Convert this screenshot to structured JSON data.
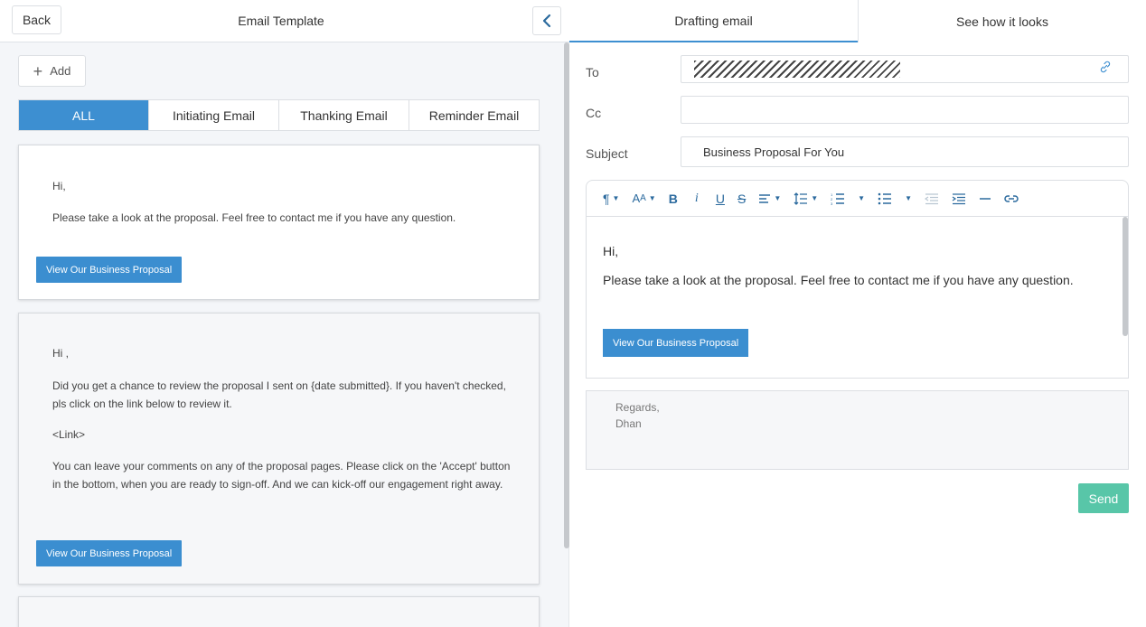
{
  "left_panel": {
    "back_label": "Back",
    "title": "Email Template",
    "add_label": "Add",
    "filters": [
      "ALL",
      "Initiating Email",
      "Thanking Email",
      "Reminder Email"
    ],
    "active_filter": "ALL",
    "cards": [
      {
        "greeting": "Hi,",
        "paragraphs": [
          "Please take a look at the proposal. Feel free to contact me if you have any question."
        ],
        "cta": "View Our Business Proposal"
      },
      {
        "greeting": "Hi ,",
        "paragraphs": [
          "Did you get a chance to review the proposal I sent on {date submitted}. If you haven't checked, pls click on the link below to review it.",
          "<Link>",
          "You can leave your comments on any of the proposal pages. Please click on the 'Accept'  button in the bottom, when you are ready to sign-off. And we can kick-off our engagement right away."
        ],
        "cta": "View Our Business Proposal"
      }
    ]
  },
  "right_panel": {
    "tabs": [
      "Drafting email",
      "See how it looks"
    ],
    "active_tab": "Drafting email",
    "to_label": "To",
    "cc_label": "Cc",
    "cc_value": "",
    "subject_label": "Subject",
    "subject_value": "Business Proposal For You",
    "editor": {
      "greeting": "Hi,",
      "body": "Please take a look at the proposal. Feel free to contact me if you have any question.",
      "cta": "View Our Business Proposal"
    },
    "signature": {
      "line1": "Regards,",
      "line2": "Dhan"
    },
    "send_label": "Send"
  },
  "colors": {
    "accent": "#3d8fd1",
    "send": "#58c6a8",
    "toolbar_icon": "#2b6a9e"
  }
}
